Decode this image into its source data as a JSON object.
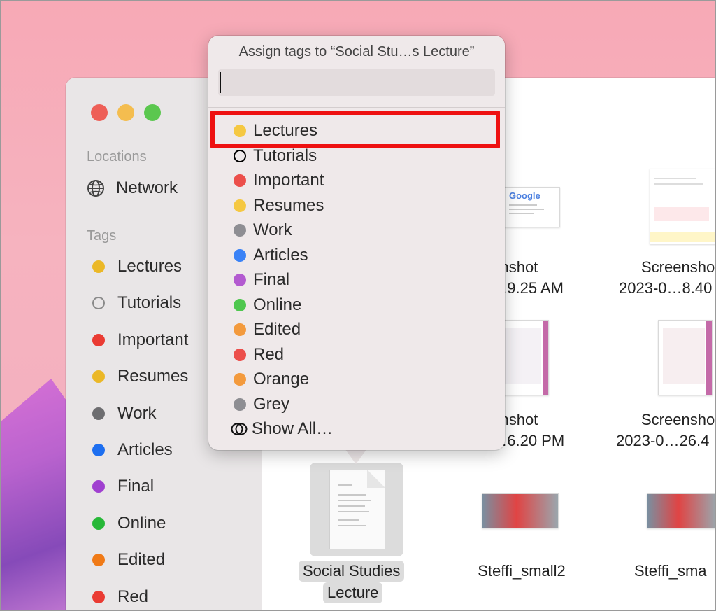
{
  "popover": {
    "title": "Assign tags to “Social Stu…s Lecture”",
    "search_value": "",
    "tags": [
      {
        "label": "Lectures",
        "color": "#f5c842",
        "hollow": false
      },
      {
        "label": "Tutorials",
        "color": "#000000",
        "hollow": true
      },
      {
        "label": "Important",
        "color": "#ec4f4b",
        "hollow": false
      },
      {
        "label": "Resumes",
        "color": "#f5c842",
        "hollow": false
      },
      {
        "label": "Work",
        "color": "#8e8e93",
        "hollow": false
      },
      {
        "label": "Articles",
        "color": "#3a82f6",
        "hollow": false
      },
      {
        "label": "Final",
        "color": "#b35ad0",
        "hollow": false
      },
      {
        "label": "Online",
        "color": "#4fc74f",
        "hollow": false
      },
      {
        "label": "Edited",
        "color": "#f39a3d",
        "hollow": false
      },
      {
        "label": "Red",
        "color": "#ec4f4b",
        "hollow": false
      },
      {
        "label": "Orange",
        "color": "#f39a3d",
        "hollow": false
      },
      {
        "label": "Grey",
        "color": "#8e8e93",
        "hollow": false
      }
    ],
    "show_all_label": "Show All…"
  },
  "sidebar": {
    "locations_heading": "Locations",
    "network_label": "Network",
    "tags_heading": "Tags",
    "tags": [
      {
        "label": "Lectures",
        "color": "#ebb827",
        "hollow": false
      },
      {
        "label": "Tutorials",
        "color": "#8a8a8a",
        "hollow": true
      },
      {
        "label": "Important",
        "color": "#ea3b33",
        "hollow": false
      },
      {
        "label": "Resumes",
        "color": "#ebb827",
        "hollow": false
      },
      {
        "label": "Work",
        "color": "#6d6d70",
        "hollow": false
      },
      {
        "label": "Articles",
        "color": "#1e6ff0",
        "hollow": false
      },
      {
        "label": "Final",
        "color": "#a040d0",
        "hollow": false
      },
      {
        "label": "Online",
        "color": "#27b838",
        "hollow": false
      },
      {
        "label": "Edited",
        "color": "#f07a17",
        "hollow": false
      },
      {
        "label": "Red",
        "color": "#ea3b33",
        "hollow": false
      }
    ]
  },
  "files": {
    "shot1_line1": "eenshot",
    "shot1_line2": "0…9.25 AM",
    "shot2_line1": "Screensho",
    "shot2_line2": "2023-0…8.40",
    "shot3_line1": "eenshot",
    "shot3_line2": "0…6.20 PM",
    "shot4_line1": "Screensho",
    "shot4_line2": "2023-0…26.4",
    "selected_line1": "Social Studies",
    "selected_line2": "Lecture",
    "img1": "Steffi_small2",
    "img2": "Steffi_sma"
  },
  "thumbnail_text": {
    "google": "Google"
  }
}
